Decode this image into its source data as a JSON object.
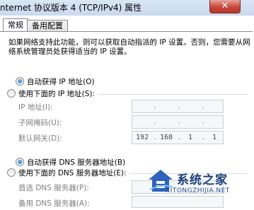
{
  "window": {
    "title": "nternet 协议版本 4 (TCP/IPv4) 属性",
    "close_glyph": "✕"
  },
  "tabs": [
    {
      "label": "常规",
      "active": true
    },
    {
      "label": "备用配置",
      "active": false
    }
  ],
  "description": "如果网络支持此功能，则可以获取自动指派的 IP 设置。否则，您需要从网络系统管理员处获得适当的 IP 设置。",
  "ip_section": {
    "auto_label": "自动获得 IP 地址(O)",
    "manual_label": "使用下面的 IP 地址(S):",
    "selected": "auto",
    "fields": [
      {
        "label": "IP 地址(I):",
        "value": [
          "",
          "",
          "",
          ""
        ]
      },
      {
        "label": "子网掩码(U):",
        "value": [
          "",
          "",
          "",
          ""
        ]
      },
      {
        "label": "默认网关(D):",
        "value": [
          "192",
          "168",
          "1",
          "1"
        ]
      }
    ]
  },
  "dns_section": {
    "auto_label": "自动获得 DNS 服务器地址(B)",
    "manual_label": "使用下面的 DNS 服务器地址(E):",
    "selected": "auto",
    "fields": [
      {
        "label": "首选 DNS 服务器(P):",
        "value": [
          "",
          "",
          "",
          ""
        ]
      },
      {
        "label": "备用 DNS 服务器(A):",
        "value": [
          "",
          "",
          "",
          ""
        ]
      }
    ]
  },
  "watermark": {
    "brand": "系统之家",
    "url": "XITONGZHIJIA.NET"
  }
}
